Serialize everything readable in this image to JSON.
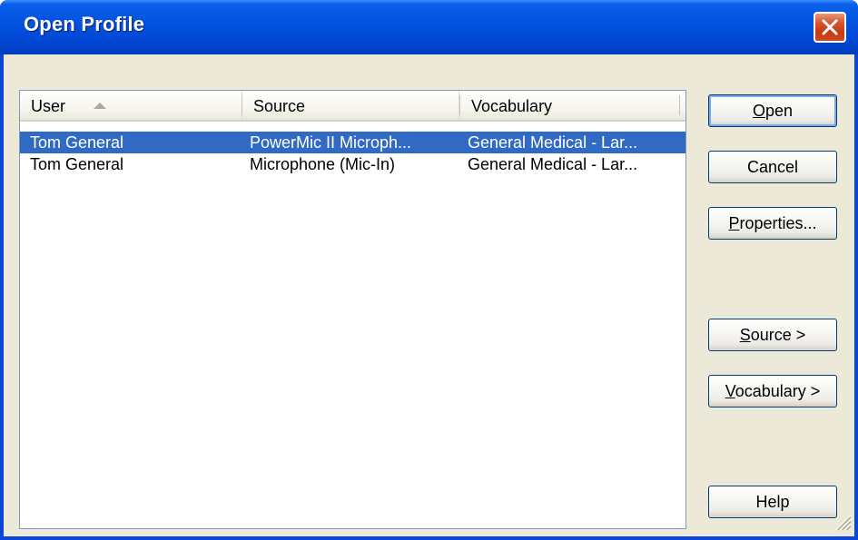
{
  "window": {
    "title": "Open Profile"
  },
  "list": {
    "columns": [
      {
        "label": "User"
      },
      {
        "label": "Source"
      },
      {
        "label": "Vocabulary"
      }
    ],
    "rows": [
      {
        "user": "Tom General",
        "source": "PowerMic II Microph...",
        "vocabulary": "General Medical - Lar...",
        "selected": true
      },
      {
        "user": "Tom General",
        "source": "Microphone (Mic-In)",
        "vocabulary": "General Medical - Lar...",
        "selected": false
      }
    ]
  },
  "buttons": {
    "open": {
      "accel": "O",
      "rest": "pen"
    },
    "cancel": {
      "label": "Cancel"
    },
    "properties": {
      "accel": "P",
      "rest": "roperties..."
    },
    "source": {
      "accel": "S",
      "rest": "ource >"
    },
    "vocabulary": {
      "accel": "V",
      "rest": "ocabulary >"
    },
    "help": {
      "label": "Help"
    }
  },
  "colors": {
    "titlebar": "#0253e0",
    "selection": "#316ac5",
    "dialog_face": "#ece9d8",
    "close_button": "#d6532b"
  },
  "icons": {
    "close": "close-x-icon",
    "sort": "sort-ascending-icon",
    "grip": "resize-grip-icon"
  }
}
